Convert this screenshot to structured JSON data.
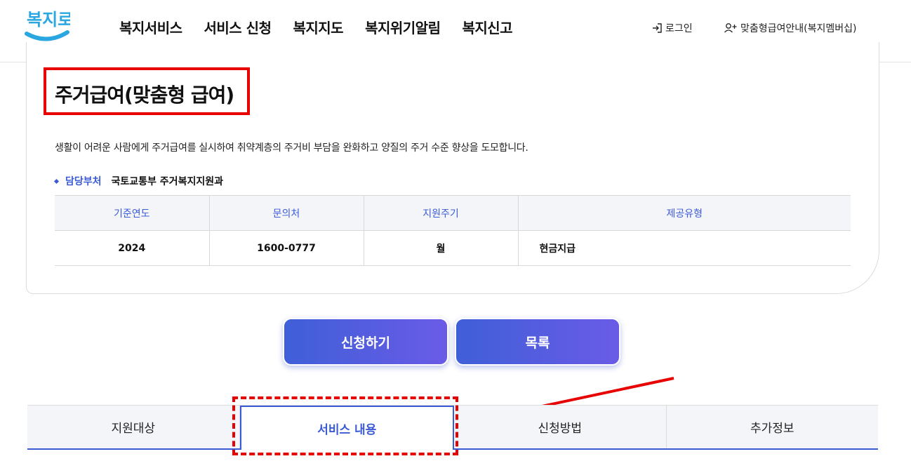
{
  "header": {
    "logo_text": "복지로",
    "nav": [
      "복지서비스",
      "서비스 신청",
      "복지지도",
      "복지위기알림",
      "복지신고"
    ],
    "login_label": "로그인",
    "member_label": "맞춤형급여안내(복지멤버십)"
  },
  "service": {
    "title": "주거급여(맞춤형 급여)",
    "description": "생활이 어려운 사람에게 주거급여를 실시하여 취약계층의 주거비 부담을 완화하고 양질의 주거 수준 향상을 도모합니다.",
    "dept_label": "담당부처",
    "dept_value": "국토교통부 주거복지지원과",
    "table": {
      "headers": [
        "기준연도",
        "문의처",
        "지원주기",
        "제공유형"
      ],
      "row": [
        "2024",
        "1600-0777",
        "월",
        "현금지급"
      ]
    }
  },
  "buttons": {
    "apply": "신청하기",
    "list": "목록"
  },
  "tabs": [
    "지원대상",
    "서비스 내용",
    "신청방법",
    "추가정보"
  ],
  "colors": {
    "accent": "#3b5bd6",
    "highlight": "#e60000",
    "button_gradient_start": "#3f5fd8",
    "button_gradient_end": "#6a5be6"
  }
}
